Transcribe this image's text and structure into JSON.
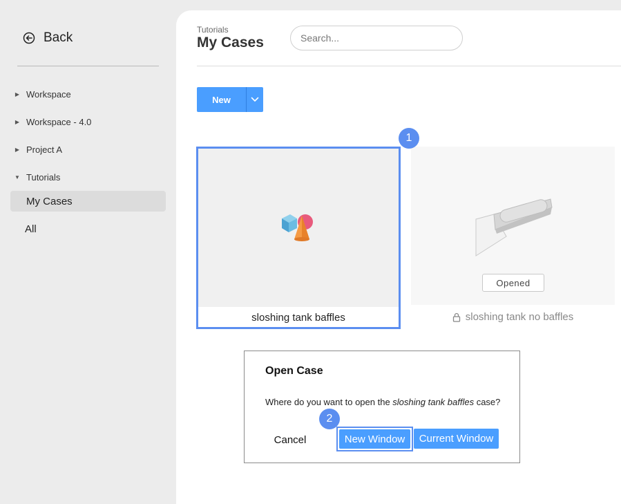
{
  "sidebar": {
    "back_label": "Back",
    "tree": [
      {
        "label": "Workspace",
        "expanded": false
      },
      {
        "label": "Workspace - 4.0",
        "expanded": false
      },
      {
        "label": "Project A",
        "expanded": false
      },
      {
        "label": "Tutorials",
        "expanded": true
      }
    ],
    "sub_items": [
      {
        "label": "My Cases",
        "active": true
      },
      {
        "label": "All",
        "active": false
      }
    ]
  },
  "header": {
    "breadcrumb": "Tutorials",
    "title": "My Cases",
    "search_placeholder": "Search..."
  },
  "toolbar": {
    "new_label": "New"
  },
  "cards": [
    {
      "name": "sloshing tank baffles",
      "selected": true,
      "locked": false
    },
    {
      "name": "sloshing tank no baffles",
      "selected": false,
      "locked": true,
      "status": "Opened"
    }
  ],
  "steps": [
    "1",
    "2"
  ],
  "dialog": {
    "title": "Open Case",
    "message_prefix": "Where do you want to open the ",
    "message_case": "sloshing tank baffles",
    "message_suffix": " case?",
    "cancel_label": "Cancel",
    "new_window_label": "New Window",
    "current_window_label": "Current Window"
  },
  "colors": {
    "accent": "#4a9eff",
    "highlight": "#5b8ef0",
    "sidebar_bg": "#ececec"
  }
}
